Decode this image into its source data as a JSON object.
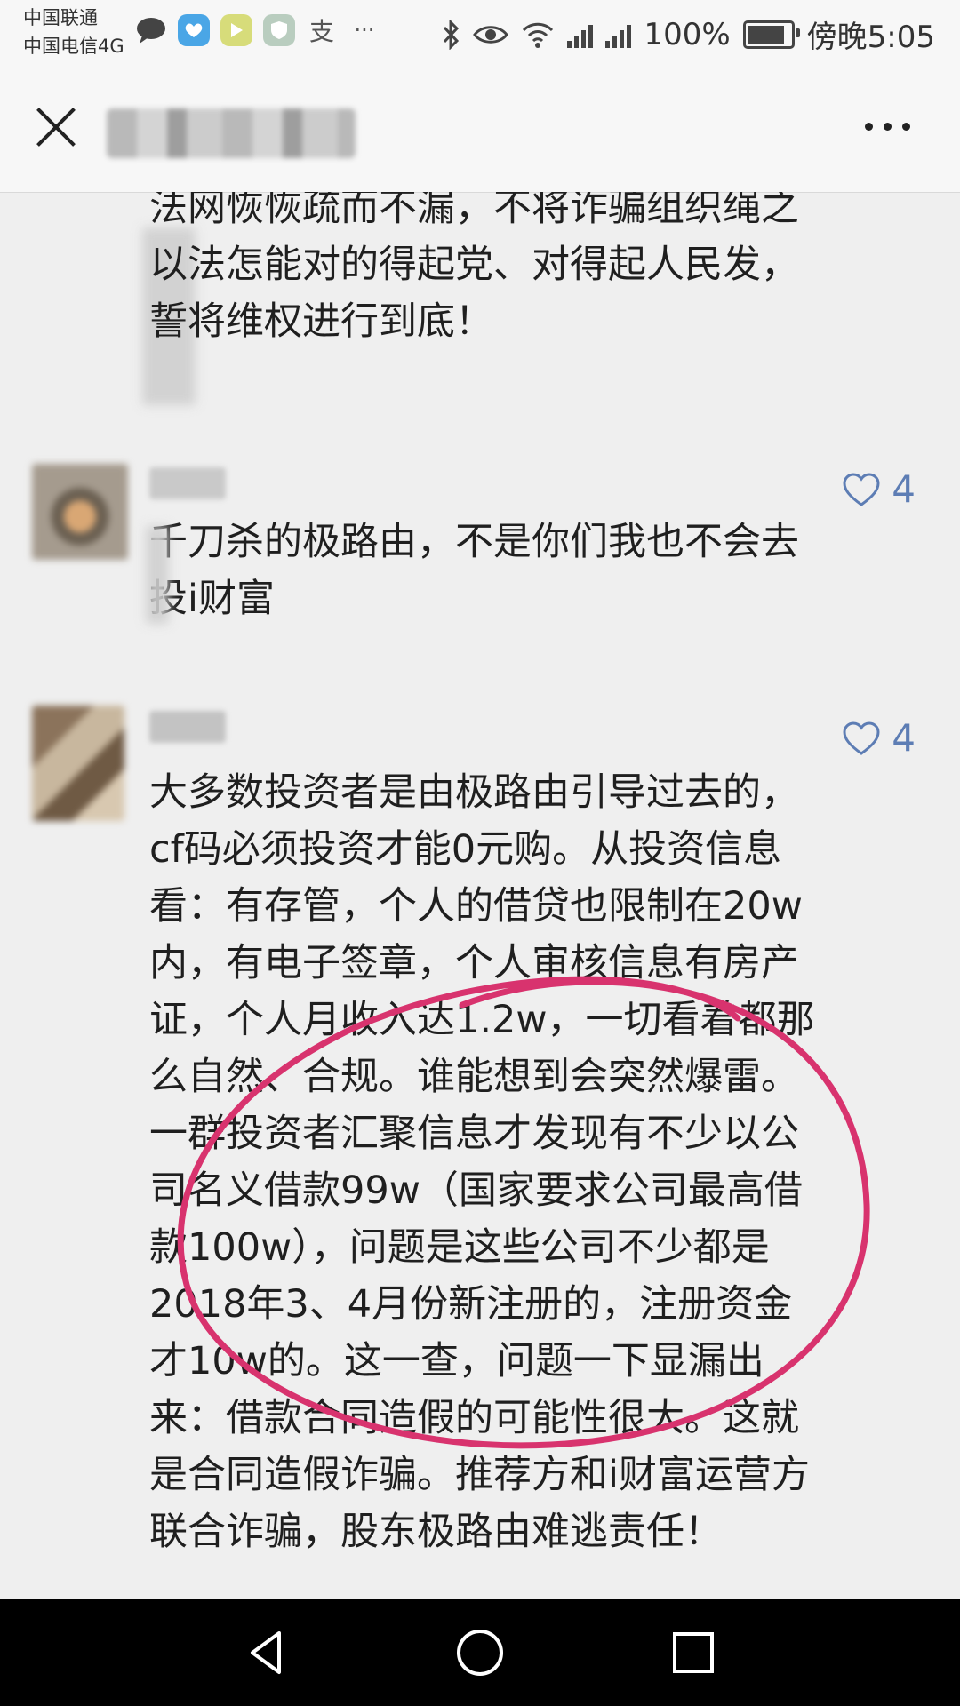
{
  "status_bar": {
    "carrier_1": "中国联通",
    "carrier_2": "中国电信4G",
    "left_icons": [
      "chat-bubble-icon",
      "app-icon-blue",
      "app-icon-play",
      "app-icon-shield",
      "alipay-icon",
      "more-notifications-icon"
    ],
    "left_icons_glyph_more": "···",
    "alipay_glyph": "支",
    "right_icons": [
      "bluetooth-icon",
      "eye-icon",
      "wifi-icon",
      "signal-e-icon",
      "signal-4g-icon"
    ],
    "battery": "100%",
    "battery_level": 1.0,
    "time": "傍晚5:05"
  },
  "title_bar": {
    "close_icon": "close-icon",
    "more_icon": "more-icon"
  },
  "comments": [
    {
      "lines": [
        "法网恢恢疏而不漏，不将诈骗组织绳之",
        "以法怎能对的得起党、对得起人民发，",
        "誓将维权进行到底！"
      ]
    },
    {
      "likes": "4",
      "lines": [
        "千刀杀的极路由，不是你们我也不会去",
        "投i财富"
      ]
    },
    {
      "likes": "4",
      "lines": [
        "大多数投资者是由极路由引导过去的，",
        "cf码必须投资才能0元购。从投资信息",
        "看：有存管，个人的借贷也限制在20w",
        "内，有电子签章，个人审核信息有房产",
        "证，个人月收入达1.2w，一切看着都那",
        "么自然、合规。谁能想到会突然爆雷。",
        "一群投资者汇聚信息才发现有不少以公",
        "司名义借款99w（国家要求公司最高借",
        "款100w），问题是这些公司不少都是",
        "2018年3、4月份新注册的，注册资金",
        "才10w的。这一查，问题一下显漏出",
        "来：借款合同造假的可能性很大。这就",
        "是合同造假诈骗。推荐方和i财富运营方",
        "联合诈骗，股东极路由难逃责任！"
      ]
    }
  ],
  "annotation_color": "#d8336e",
  "like_color": "#5d7db4",
  "nav_bar": {
    "back_icon": "back-triangle-icon",
    "home_icon": "home-circle-icon",
    "recents_icon": "recents-square-icon"
  }
}
